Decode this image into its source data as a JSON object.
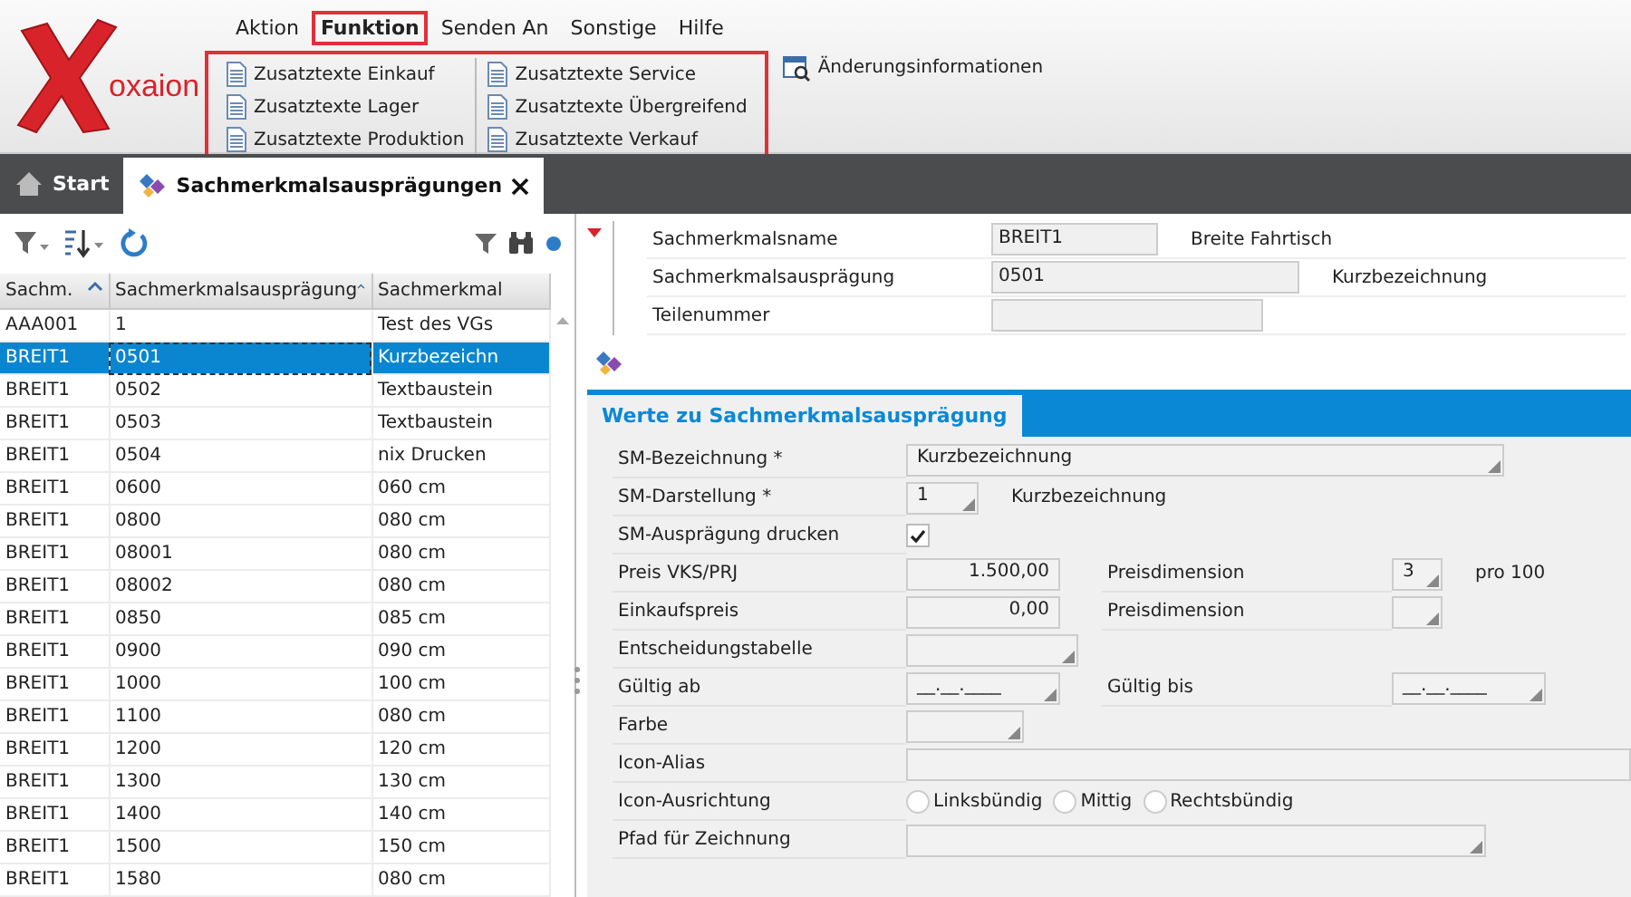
{
  "logo": "oxaion",
  "menu": [
    {
      "label": "Aktion",
      "selected": false,
      "highlighted": false
    },
    {
      "label": "Funktion",
      "selected": true,
      "highlighted": true
    },
    {
      "label": "Senden An",
      "selected": false,
      "highlighted": false
    },
    {
      "label": "Sonstige",
      "selected": false,
      "highlighted": false
    },
    {
      "label": "Hilfe",
      "selected": false,
      "highlighted": false
    }
  ],
  "ribbon": {
    "highlighted": true,
    "columns": [
      [
        "Zusatztexte Einkauf",
        "Zusatztexte Lager",
        "Zusatztexte Produktion"
      ],
      [
        "Zusatztexte Service",
        "Zusatztexte Übergreifend",
        "Zusatztexte Verkauf"
      ]
    ],
    "extra": "Änderungsinformationen"
  },
  "tabs": [
    {
      "label": "Start",
      "selected": false,
      "kind": "home",
      "closable": false
    },
    {
      "label": "Sachmerkmalsausprägungen",
      "selected": true,
      "kind": "document",
      "closable": true
    }
  ],
  "table": {
    "columns": [
      "Sachm.",
      "Sachmerkmalsausprägung",
      "Sachmerkmal"
    ],
    "rows": [
      {
        "cells": [
          "AAA001",
          "1",
          "Test des VGs"
        ],
        "selected": false
      },
      {
        "cells": [
          "BREIT1",
          "0501",
          "Kurzbezeichn"
        ],
        "selected": true
      },
      {
        "cells": [
          "BREIT1",
          "0502",
          "Textbaustein"
        ],
        "selected": false
      },
      {
        "cells": [
          "BREIT1",
          "0503",
          "Textbaustein"
        ],
        "selected": false
      },
      {
        "cells": [
          "BREIT1",
          "0504",
          "nix Drucken"
        ],
        "selected": false
      },
      {
        "cells": [
          "BREIT1",
          "0600",
          "060 cm"
        ],
        "selected": false
      },
      {
        "cells": [
          "BREIT1",
          "0800",
          "080 cm"
        ],
        "selected": false
      },
      {
        "cells": [
          "BREIT1",
          "08001",
          "080 cm"
        ],
        "selected": false
      },
      {
        "cells": [
          "BREIT1",
          "08002",
          "080 cm"
        ],
        "selected": false
      },
      {
        "cells": [
          "BREIT1",
          "0850",
          "085 cm"
        ],
        "selected": false
      },
      {
        "cells": [
          "BREIT1",
          "0900",
          "090 cm"
        ],
        "selected": false
      },
      {
        "cells": [
          "BREIT1",
          "1000",
          "100 cm"
        ],
        "selected": false
      },
      {
        "cells": [
          "BREIT1",
          "1100",
          "080 cm"
        ],
        "selected": false
      },
      {
        "cells": [
          "BREIT1",
          "1200",
          "120 cm"
        ],
        "selected": false
      },
      {
        "cells": [
          "BREIT1",
          "1300",
          "130 cm"
        ],
        "selected": false
      },
      {
        "cells": [
          "BREIT1",
          "1400",
          "140 cm"
        ],
        "selected": false
      },
      {
        "cells": [
          "BREIT1",
          "1500",
          "150 cm"
        ],
        "selected": false
      },
      {
        "cells": [
          "BREIT1",
          "1580",
          "080 cm"
        ],
        "selected": false
      }
    ]
  },
  "header_fields": [
    {
      "label": "Sachmerkmalsname",
      "value": "BREIT1",
      "note": "Breite Fahrtisch"
    },
    {
      "label": "Sachmerkmalsausprägung",
      "value": "0501",
      "note": "Kurzbezeichnung"
    },
    {
      "label": "Teilenummer"
    }
  ],
  "section_tab": "Werte zu Sachmerkmalsausprägung",
  "form": [
    {
      "label": "SM-Bezeichnung *",
      "kind": "dropdown",
      "value": "Kurzbezeichnung"
    },
    {
      "label": "SM-Darstellung *",
      "kind": "dropdown",
      "value": "1",
      "note": "Kurzbezeichnung"
    },
    {
      "label": "SM-Ausprägung drucken",
      "kind": "checkbox",
      "checked": true
    },
    {
      "label": "Preis VKS/PRJ",
      "kind": "number",
      "value": "1.500,00",
      "right": {
        "label": "Preisdimension",
        "value": "3",
        "note": "pro 100"
      }
    },
    {
      "label": "Einkaufspreis",
      "kind": "number",
      "value": "0,00",
      "right": {
        "label": "Preisdimension"
      }
    },
    {
      "label": "Entscheidungstabelle",
      "kind": "dropdown"
    },
    {
      "label": "Gültig ab",
      "kind": "dropdown",
      "value": "__.__.____",
      "right": {
        "label": "Gültig bis",
        "value": "__.__.____"
      }
    },
    {
      "label": "Farbe",
      "kind": "dropdown"
    },
    {
      "label": "Icon-Alias",
      "kind": "text"
    },
    {
      "label": "Icon-Ausrichtung",
      "kind": "radios",
      "options": [
        {
          "label": "Linksbündig",
          "selected": false
        },
        {
          "label": "Mittig",
          "selected": false
        },
        {
          "label": "Rechtsbündig",
          "selected": false
        }
      ]
    },
    {
      "label": "Pfad für Zeichnung",
      "kind": "dropdown"
    }
  ]
}
